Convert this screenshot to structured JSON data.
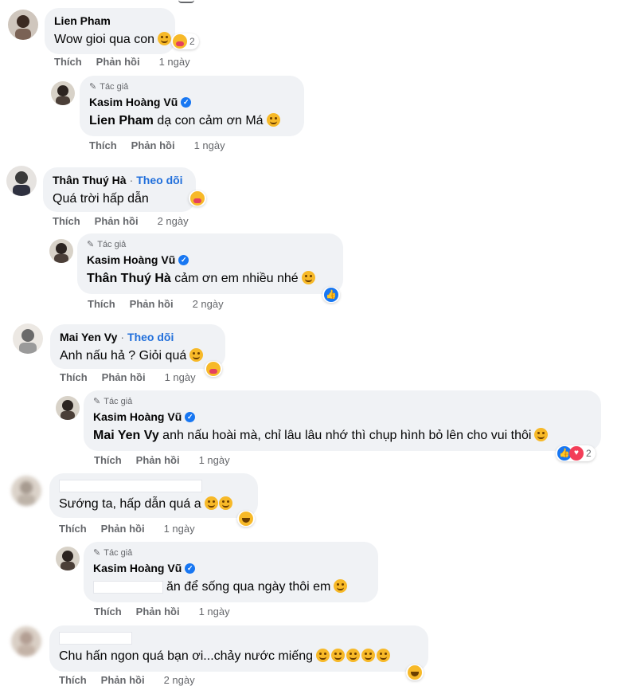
{
  "labels": {
    "like": "Thích",
    "reply": "Phản hồi",
    "author": "Tác giả",
    "follow": "Theo dõi",
    "dot": "·"
  },
  "comments": [
    {
      "name": "Lien Pham",
      "text": "Wow gioi qua con",
      "reaction_count": "2",
      "time": "1 ngày"
    },
    {
      "name": "Kasim Hoàng Vũ",
      "mention": "Lien Pham",
      "text": " dạ con cảm ơn Má",
      "time": "1 ngày"
    },
    {
      "name": "Thân Thuý Hà",
      "text": "Quá trời hấp dẫn",
      "time": "2 ngày"
    },
    {
      "name": "Kasim Hoàng Vũ",
      "mention": "Thân Thuý Hà",
      "text": " cảm ơn em nhiều nhé",
      "time": "2 ngày"
    },
    {
      "name": "Mai Yen Vy",
      "text": "Anh nấu hả ? Giỏi quá",
      "time": "1 ngày"
    },
    {
      "name": "Kasim Hoàng Vũ",
      "mention": "Mai Yen Vy",
      "text": " anh nấu hoài mà, chỉ lâu lâu nhớ thì chụp hình bỏ lên cho vui thôi",
      "reaction_count": "2",
      "time": "1 ngày"
    },
    {
      "text": "Sướng ta, hấp dẫn quá a",
      "time": "1 ngày"
    },
    {
      "name": "Kasim Hoàng Vũ",
      "text": "ăn để sống qua ngày thôi em",
      "time": "1 ngày"
    },
    {
      "text": "Chu hấn ngon quá bạn ơi...chảy nước miếng",
      "time": "2 ngày"
    }
  ],
  "colors": {
    "bubble": "#f0f2f5",
    "link": "#216fdb",
    "verified": "#1877f2",
    "meta": "#65676b"
  }
}
